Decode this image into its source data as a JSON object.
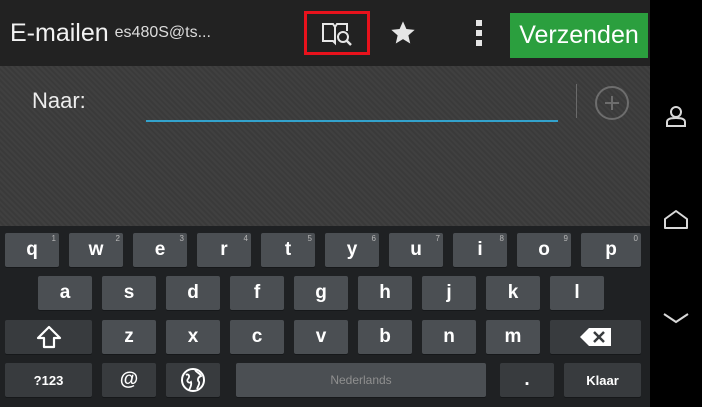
{
  "action_bar": {
    "title": "E-mailen",
    "account": "es480S@ts...",
    "send_label": "Verzenden",
    "icons": [
      "contacts-search-icon",
      "star-icon",
      "overflow-menu-icon"
    ]
  },
  "compose": {
    "to_label": "Naar:",
    "to_value": "",
    "add_icon": "plus-circle-icon"
  },
  "keyboard": {
    "row1": [
      {
        "key": "q",
        "hint": "1"
      },
      {
        "key": "w",
        "hint": "2"
      },
      {
        "key": "e",
        "hint": "3"
      },
      {
        "key": "r",
        "hint": "4"
      },
      {
        "key": "t",
        "hint": "5"
      },
      {
        "key": "y",
        "hint": "6"
      },
      {
        "key": "u",
        "hint": "7"
      },
      {
        "key": "i",
        "hint": "8"
      },
      {
        "key": "o",
        "hint": "9"
      },
      {
        "key": "p",
        "hint": "0"
      }
    ],
    "row2": [
      "a",
      "s",
      "d",
      "f",
      "g",
      "h",
      "j",
      "k",
      "l"
    ],
    "row3": [
      "z",
      "x",
      "c",
      "v",
      "b",
      "n",
      "m"
    ],
    "symbols_label": "?123",
    "at_label": "@",
    "space_label": "Nederlands",
    "period_label": ".",
    "done_label": "Klaar",
    "shift_icon": "shift-icon",
    "backspace_icon": "backspace-icon",
    "language_icon": "globe-icon"
  },
  "navigation": [
    "home-icon",
    "recent-apps-icon",
    "back-icon"
  ],
  "colors": {
    "send_button": "#2b9f3e",
    "highlight_border": "#e8121c",
    "input_underline": "#33a2cc",
    "key_background": "#4b4f53"
  }
}
